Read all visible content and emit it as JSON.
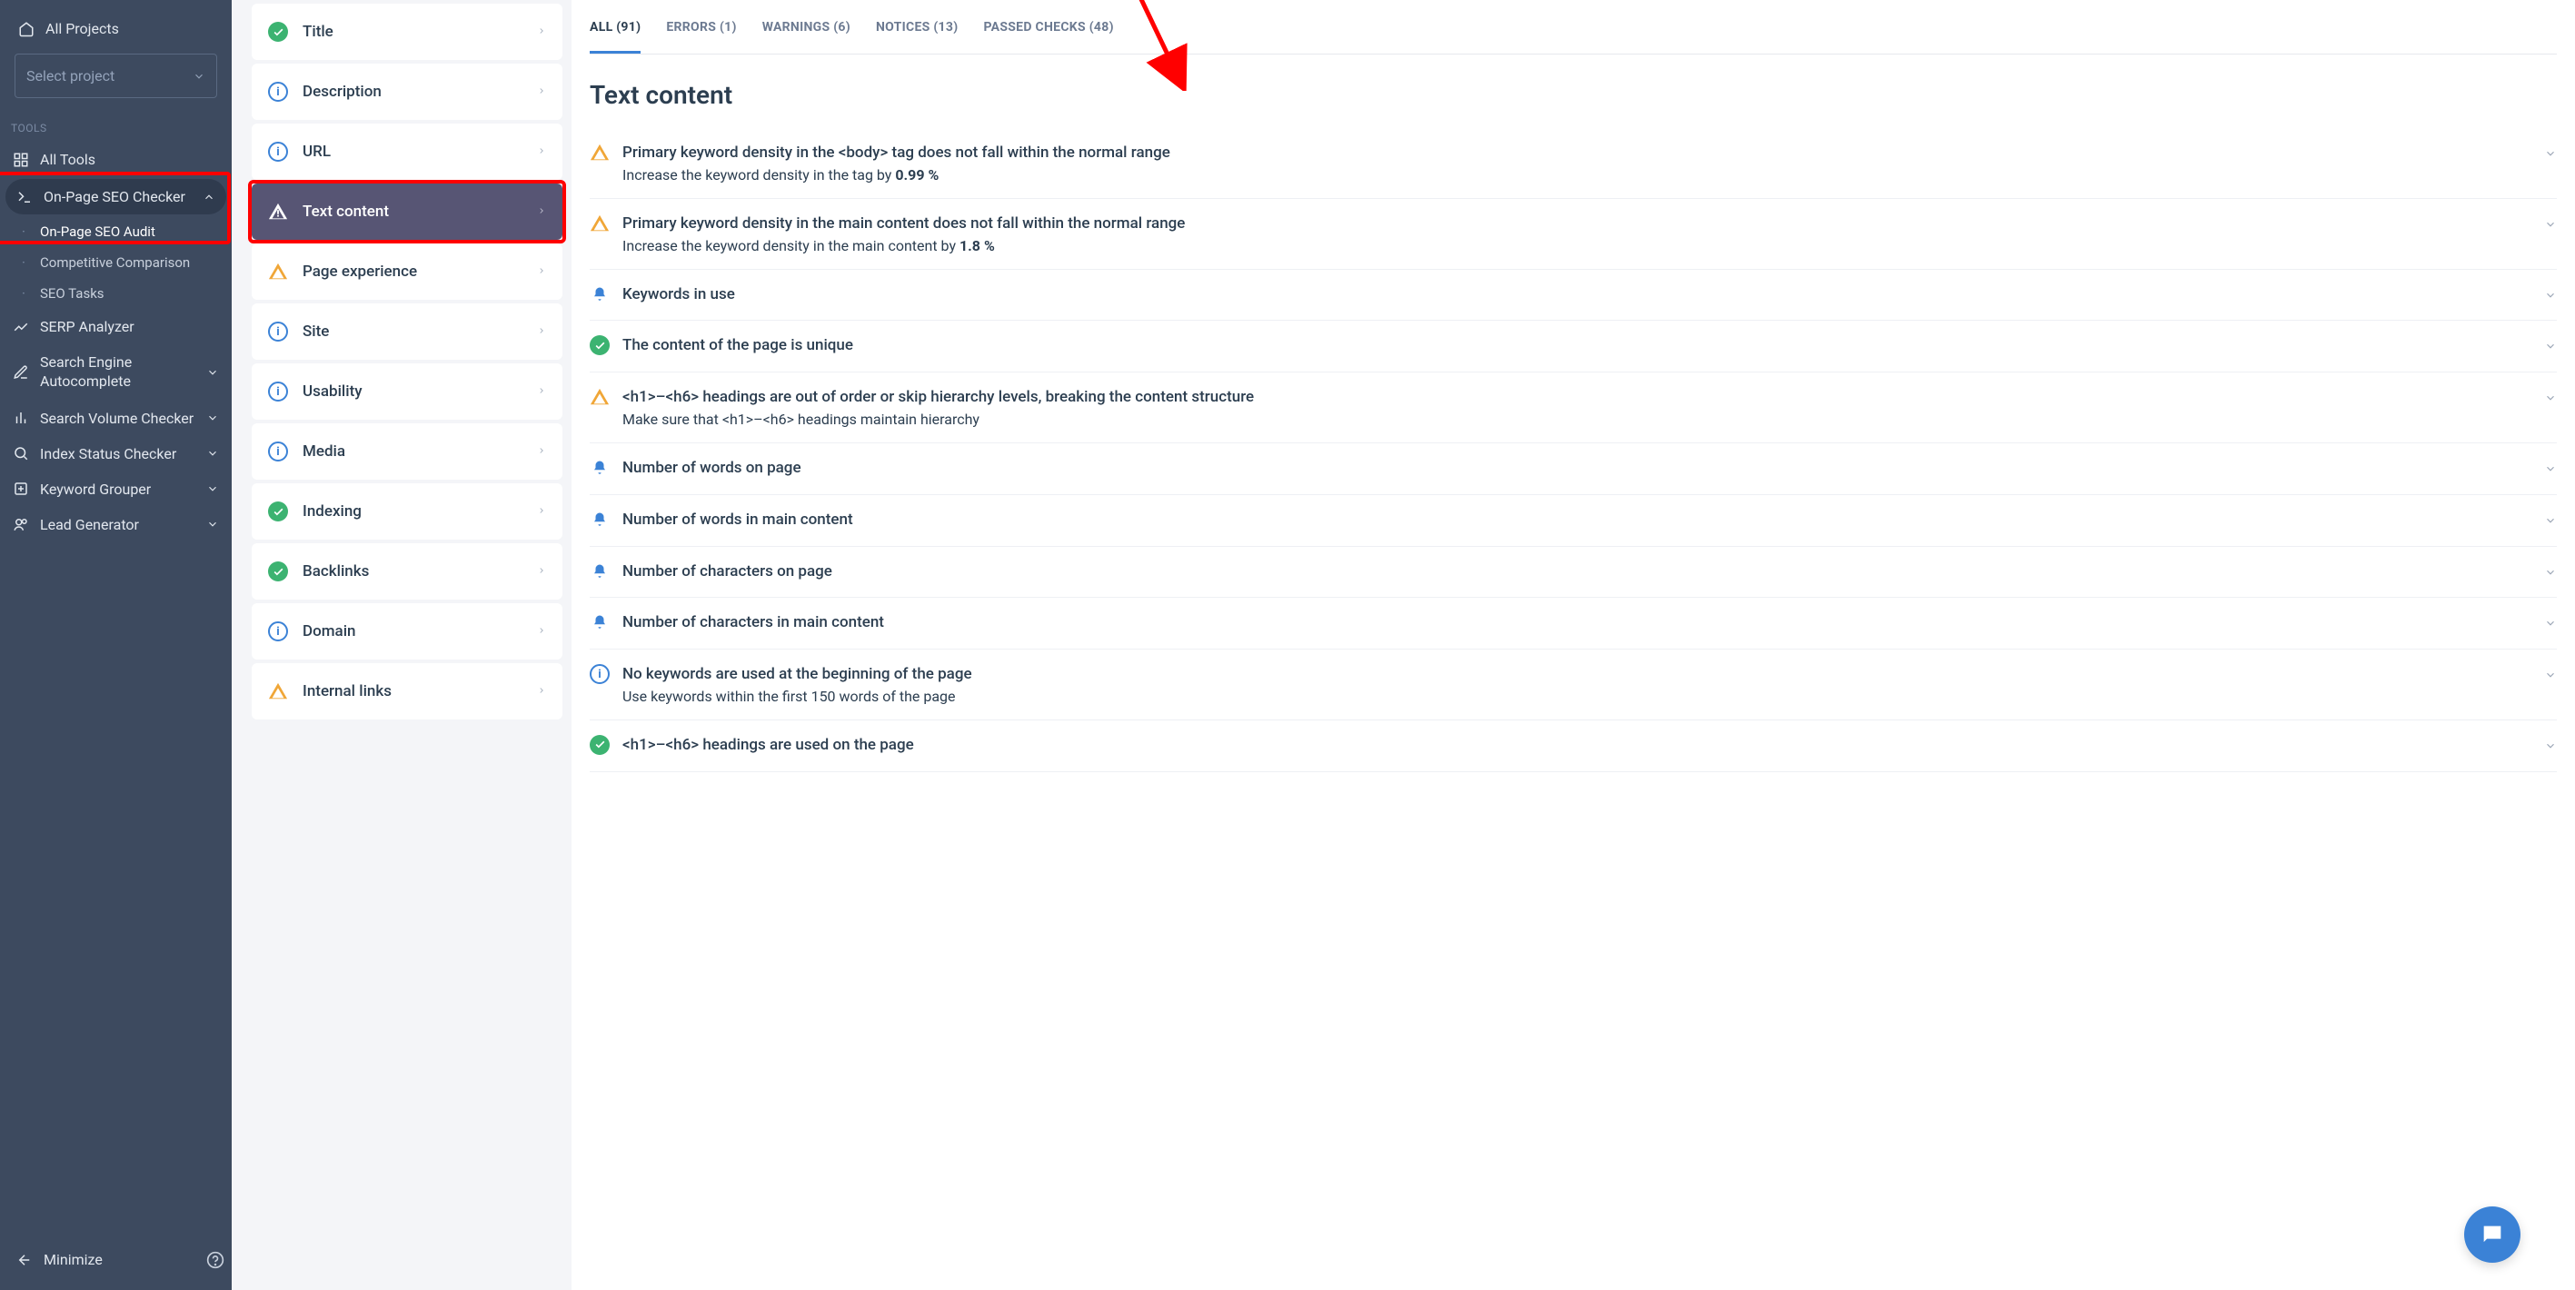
{
  "sidebar": {
    "all_projects": "All Projects",
    "select_placeholder": "Select project",
    "tools_label": "TOOLS",
    "items": [
      {
        "label": "All Tools",
        "icon": "grid"
      },
      {
        "label": "On-Page SEO Checker",
        "icon": "code",
        "expanded": true,
        "children": [
          {
            "label": "On-Page SEO Audit",
            "active": true
          },
          {
            "label": "Competitive Comparison"
          },
          {
            "label": "SEO Tasks"
          }
        ]
      },
      {
        "label": "SERP Analyzer",
        "icon": "chart"
      },
      {
        "label": "Search Engine Autocomplete",
        "icon": "edit"
      },
      {
        "label": "Search Volume Checker",
        "icon": "bars"
      },
      {
        "label": "Index Status Checker",
        "icon": "search"
      },
      {
        "label": "Keyword Grouper",
        "icon": "plus-doc"
      },
      {
        "label": "Lead Generator",
        "icon": "users"
      }
    ],
    "minimize": "Minimize"
  },
  "categories": [
    {
      "label": "Title",
      "status": "ok"
    },
    {
      "label": "Description",
      "status": "info"
    },
    {
      "label": "URL",
      "status": "info"
    },
    {
      "label": "Text content",
      "status": "warn",
      "active": true
    },
    {
      "label": "Page experience",
      "status": "warn"
    },
    {
      "label": "Site",
      "status": "info"
    },
    {
      "label": "Usability",
      "status": "info"
    },
    {
      "label": "Media",
      "status": "info"
    },
    {
      "label": "Indexing",
      "status": "ok"
    },
    {
      "label": "Backlinks",
      "status": "ok"
    },
    {
      "label": "Domain",
      "status": "info"
    },
    {
      "label": "Internal links",
      "status": "warn"
    }
  ],
  "tabs": [
    {
      "label": "ALL (91)",
      "active": true
    },
    {
      "label": "ERRORS (1)"
    },
    {
      "label": "WARNINGS (6)"
    },
    {
      "label": "NOTICES (13)"
    },
    {
      "label": "PASSED CHECKS (48)"
    }
  ],
  "main_title": "Text content",
  "issues": [
    {
      "icon": "warn",
      "title": "Primary keyword density in the <body> tag does not fall within the normal range",
      "sub_pre": "Increase the keyword density in the tag by ",
      "sub_bold": "0.99 %"
    },
    {
      "icon": "warn",
      "title": "Primary keyword density in the main content does not fall within the normal range",
      "sub_pre": "Increase the keyword density in the main content by ",
      "sub_bold": "1.8 %"
    },
    {
      "icon": "notice",
      "title": "Keywords in use"
    },
    {
      "icon": "ok",
      "title": "The content of the page is unique"
    },
    {
      "icon": "warn",
      "title": "<h1>–<h6> headings are out of order or skip hierarchy levels, breaking the content structure",
      "sub_pre": "Make sure that <h1>–<h6> headings maintain hierarchy"
    },
    {
      "icon": "notice",
      "title": "Number of words on page"
    },
    {
      "icon": "notice",
      "title": "Number of words in main content"
    },
    {
      "icon": "notice",
      "title": "Number of characters on page"
    },
    {
      "icon": "notice",
      "title": "Number of characters in main content"
    },
    {
      "icon": "info",
      "title": "No keywords are used at the beginning of the page",
      "sub_pre": "Use keywords within the first 150 words of the page"
    },
    {
      "icon": "ok",
      "title": "<h1>–<h6> headings are used on the page"
    }
  ]
}
